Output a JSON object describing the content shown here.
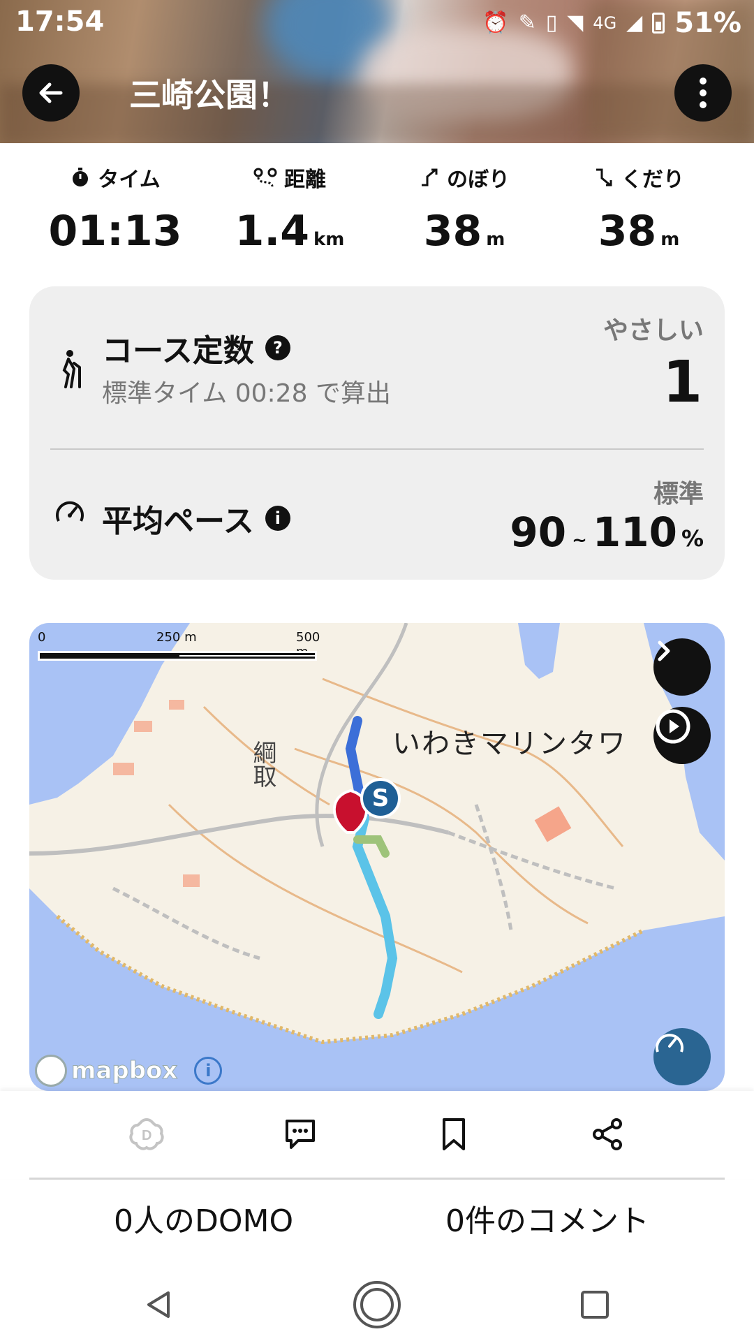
{
  "status_bar": {
    "time": "17:54",
    "network": "4G",
    "battery": "51%"
  },
  "header": {
    "title": "三崎公園！"
  },
  "stats": [
    {
      "label": "タイム",
      "value": "01:13",
      "unit": "",
      "icon": "stopwatch-icon"
    },
    {
      "label": "距離",
      "value": "1.4",
      "unit": "km",
      "icon": "route-icon"
    },
    {
      "label": "のぼり",
      "value": "38",
      "unit": "m",
      "icon": "ascent-icon"
    },
    {
      "label": "くだり",
      "value": "38",
      "unit": "m",
      "icon": "descent-icon"
    }
  ],
  "course": {
    "title": "コース定数",
    "subtitle": "標準タイム 00:28 で算出",
    "level_label": "やさしい",
    "level_value": "1"
  },
  "pace": {
    "title": "平均ペース",
    "standard_label": "標準",
    "min": "90",
    "tilde": "~",
    "max": "110",
    "unit": "%"
  },
  "map": {
    "scale_0": "0",
    "scale_mid": "250 m",
    "scale_max": "500 m",
    "place_label": "いわきマリンタワ",
    "area_label": "綱取",
    "start_marker": "S",
    "attribution": "mapbox",
    "colors": {
      "land": "#f6f1e6",
      "water": "#a9c2f5",
      "route": "#5bc3e8",
      "route_start": "#9ec37a",
      "route_end": "#3c6fd8"
    }
  },
  "actions": {
    "domo_count": "0人のDOMO",
    "comment_count": "0件のコメント"
  }
}
